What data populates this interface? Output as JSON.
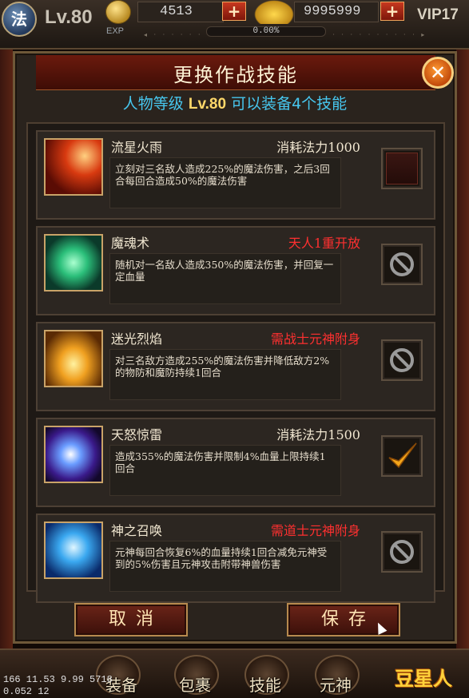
{
  "topbar": {
    "class_label": "法",
    "level": "Lv.80",
    "exp_label": "EXP",
    "exp_percent": "0.00%",
    "exp_fraction": 0.0,
    "silver": "4513",
    "gold": "9995999",
    "plus_label": "+",
    "vip": "VIP17"
  },
  "panel": {
    "title": "更换作战技能",
    "subtitle_prefix": "人物等级",
    "subtitle_level": "Lv.80",
    "subtitle_suffix": "可以装备4个技能",
    "close_label": "✕"
  },
  "skills": [
    {
      "name": "流星火雨",
      "cost": "消耗法力1000",
      "cost_red": false,
      "desc": "立刻对三名敌人造成225%的魔法伤害，之后3回合每回合造成50%的魔法伤害",
      "slot": "empty",
      "icon": "meteor-icon"
    },
    {
      "name": "魔魂术",
      "cost": "天人1重开放",
      "cost_red": true,
      "desc": "随机对一名敌人造成350%的魔法伤害，并回复一定血量",
      "slot": "locked",
      "icon": "soul-paw-icon"
    },
    {
      "name": "迷光烈焰",
      "cost": "需战士元神附身",
      "cost_red": true,
      "desc": "对三名敌方造成255%的魔法伤害并降低敌方2%的物防和魔防持续1回合",
      "slot": "locked",
      "icon": "flame-pillar-icon"
    },
    {
      "name": "天怒惊雷",
      "cost": "消耗法力1500",
      "cost_red": false,
      "desc": "造成355%的魔法伤害并限制4%血量上限持续1回合",
      "slot": "checked",
      "icon": "thunder-orb-icon"
    },
    {
      "name": "神之召唤",
      "cost": "需道士元神附身",
      "cost_red": true,
      "desc": "元神每回合恢复6%的血量持续1回合减免元神受到的5%伤害且元神攻击附带神兽伤害",
      "slot": "locked",
      "icon": "divine-summon-icon"
    }
  ],
  "buttons": {
    "cancel": "取消",
    "save": "保存"
  },
  "bottombar": {
    "debug_line1": "166 11.53 9.99 5718",
    "debug_line2": "0.052 12",
    "menu": [
      "装备",
      "包裹",
      "技能",
      "元神"
    ],
    "watermark": "豆星人"
  },
  "colors": {
    "accent_red": "#ff3030",
    "subtitle_blue": "#47c7ef",
    "level_gold": "#ffd86a"
  }
}
